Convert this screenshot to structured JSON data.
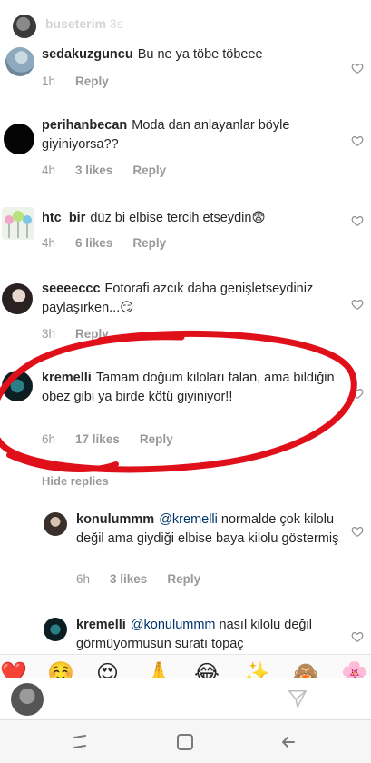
{
  "story_header": {
    "username": "buseterim",
    "time": "3s"
  },
  "comments": [
    {
      "username": "sedakuzguncu",
      "text": "Bu ne ya töbe töbeee",
      "time": "1h",
      "likes": "",
      "reply": "Reply"
    },
    {
      "username": "perihanbecan",
      "text": "Moda dan anlayanlar böyle giyiniyorsa??",
      "time": "4h",
      "likes": "3 likes",
      "reply": "Reply"
    },
    {
      "username": "htc_bir",
      "text": "düz bi elbise tercih etseydin😨",
      "time": "4h",
      "likes": "6 likes",
      "reply": "Reply"
    },
    {
      "username": "seeeeccc",
      "text": "Fotorafi azcık daha genişletseydiniz paylaşırken...😏",
      "time": "3h",
      "likes": "",
      "reply": "Reply"
    },
    {
      "username": "kremelli",
      "text": "Tamam doğum kiloları falan, ama bildiğin obez gibi ya birde kötü giyiniyor!!",
      "time": "6h",
      "likes": "17 likes",
      "reply": "Reply"
    }
  ],
  "view_replies": "Hide replies",
  "replies": [
    {
      "username": "konulummm",
      "mention": "@kremelli",
      "text": "normalde çok kilolu değil ama giydiği elbise baya kilolu göstermiş",
      "time": "6h",
      "likes": "3 likes",
      "reply": "Reply"
    },
    {
      "username": "kremelli",
      "mention": "@konulummm",
      "text": "nasıl kilolu değil görmüyormusun suratı topaç",
      "time": "",
      "likes": "",
      "reply": ""
    }
  ],
  "emoji_bar": [
    "❤️",
    "☺️",
    "😍",
    "🙏",
    "😂",
    "✨",
    "🙈",
    "🌸"
  ],
  "colors": {
    "annotation": "#e0101a",
    "meta": "#999999",
    "mention": "#003569"
  }
}
